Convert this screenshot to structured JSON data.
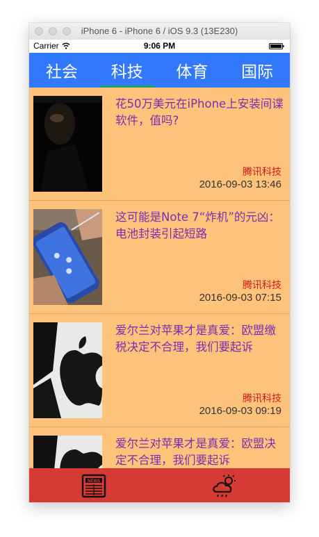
{
  "window": {
    "title": "iPhone 6 - iPhone 6 / iOS 9.3 (13E230)"
  },
  "statusbar": {
    "carrier": "Carrier",
    "time": "9:06 PM"
  },
  "tabs": [
    {
      "label": "社会",
      "selected": false
    },
    {
      "label": "科技",
      "selected": true
    },
    {
      "label": "体育",
      "selected": false
    },
    {
      "label": "国际",
      "selected": false
    }
  ],
  "news": [
    {
      "title": "花50万美元在iPhone上安装间谍软件，值吗?",
      "source": "腾讯科技",
      "date": "2016-09-03 13:46"
    },
    {
      "title": "这可能是Note 7“炸机”的元凶：电池封装引起短路",
      "source": "腾讯科技",
      "date": "2016-09-03 07:15"
    },
    {
      "title": "爱尔兰对苹果才是真爱：欧盟缴税决定不合理，我们要起诉",
      "source": "腾讯科技",
      "date": "2016-09-03 09:19"
    },
    {
      "title": "爱尔兰对苹果才是真爱：欧盟决定不合理，我们要起诉",
      "source": "",
      "date": ""
    }
  ],
  "bottombar": {
    "news_icon": "newspaper-icon",
    "weather_icon": "weather-icon"
  },
  "colors": {
    "tab_bg": "#3278fa",
    "tab_underline": "#1aa06b",
    "list_bg": "#fdc37b",
    "title_text": "#7b2fb0",
    "source_text": "#d0191b",
    "bottom_bar": "#d63a34"
  }
}
